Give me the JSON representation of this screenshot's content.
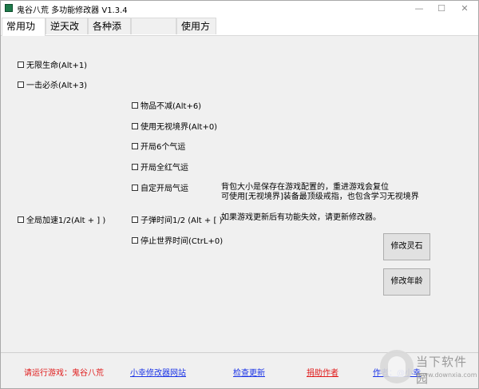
{
  "window": {
    "title": "鬼谷八荒 多功能修改器  V1.3.4",
    "minimize": "—",
    "maximize": "☐",
    "close": "✕"
  },
  "tabs": [
    {
      "label": "常用功能",
      "active": true
    },
    {
      "label": "逆天改命",
      "active": false
    },
    {
      "label": "各种添加",
      "active": false
    },
    {
      "label": "",
      "active": false
    },
    {
      "label": "使用方法",
      "active": false
    }
  ],
  "left_options": [
    {
      "label": "无限生命(Alt+1)",
      "checked": false
    },
    {
      "label": "一击必杀(Alt+3)",
      "checked": false
    },
    {
      "label": "全局加速1/2(Alt + ] )",
      "checked": false
    }
  ],
  "middle_options": [
    {
      "label": "物品不减(Alt+6)",
      "checked": false
    },
    {
      "label": "使用无视境界(Alt+0)",
      "checked": false
    },
    {
      "label": "开局6个气运",
      "checked": false
    },
    {
      "label": "开局全红气运",
      "checked": false
    },
    {
      "label": "自定开局气运",
      "checked": false
    },
    {
      "label": "子弹时间1/2 (Alt + [ )",
      "checked": false
    },
    {
      "label": "停止世界时间(CtrL+0)",
      "checked": false
    }
  ],
  "notes": {
    "line1": "背包大小是保存在游戏配置的，重进游戏会复位",
    "line2": "可使用[无视境界]装备最顶级戒指，也包含学习无视境界",
    "line3": "如果游戏更新后有功能失效，请更新修改器。"
  },
  "buttons": {
    "spirit_stone": "修改灵石",
    "age": "修改年龄"
  },
  "footer": {
    "run_game": "请运行游戏：鬼谷八荒",
    "website": "小幸修改器网站",
    "check_update": "检查更新",
    "donate": "捐助作者",
    "author": "作者：@小幸"
  },
  "watermark": {
    "name": "当下软件园",
    "url": "www.downxia.com"
  },
  "colors": {
    "content_bg": "#f0f0f0",
    "link_blue": "#1a33e6",
    "link_red": "#e01a1a"
  }
}
